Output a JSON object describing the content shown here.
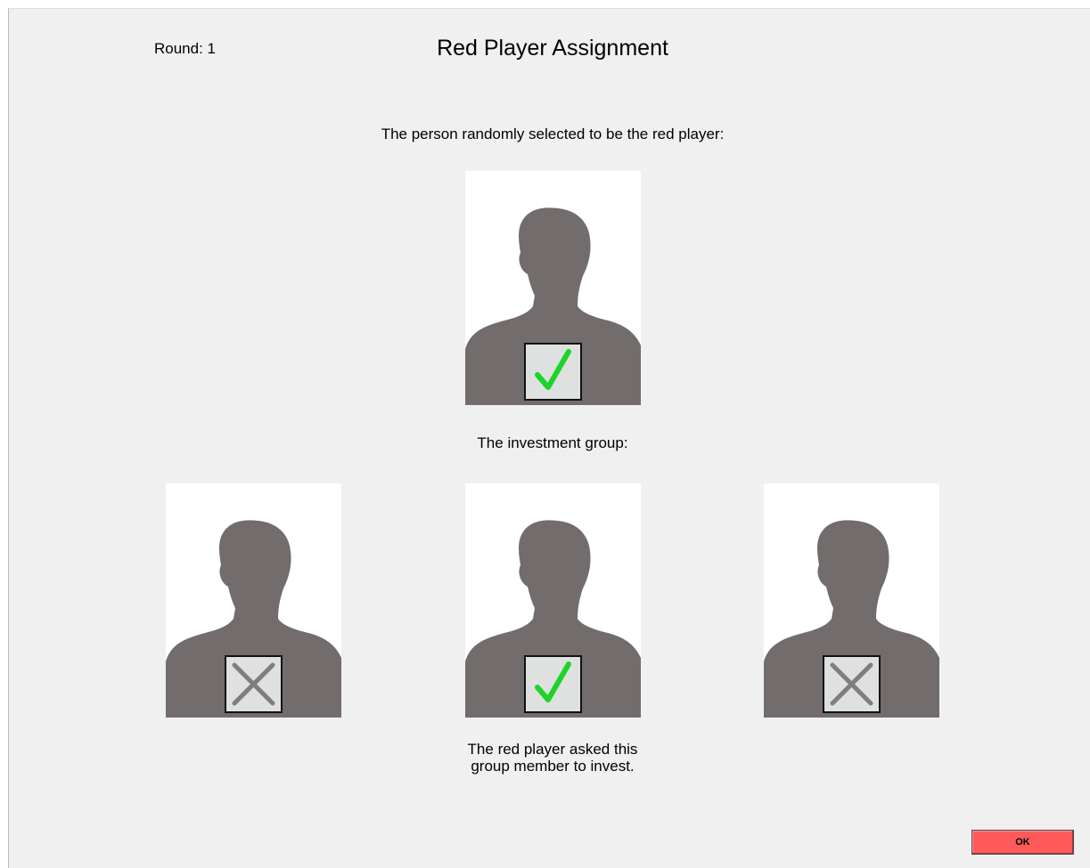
{
  "header": {
    "round_label": "Round: 1",
    "title": "Red Player Assignment"
  },
  "selected_section": {
    "caption": "The person randomly selected to be the red player:",
    "photo": {
      "mark": "check-icon"
    }
  },
  "group_section": {
    "caption": "The investment group:",
    "members": [
      {
        "mark": "cross-icon"
      },
      {
        "mark": "check-icon"
      },
      {
        "mark": "cross-icon"
      }
    ],
    "note_line1": "The red player asked this",
    "note_line2": "group member to invest."
  },
  "ok_button": {
    "label": "OK",
    "color": "#ff5a5a"
  },
  "colors": {
    "silhouette": "#726c6c",
    "check": "#1ed42b",
    "cross": "#7e7e7e",
    "mark_box": "#dfe1e1",
    "background": "#f0f0f0"
  }
}
